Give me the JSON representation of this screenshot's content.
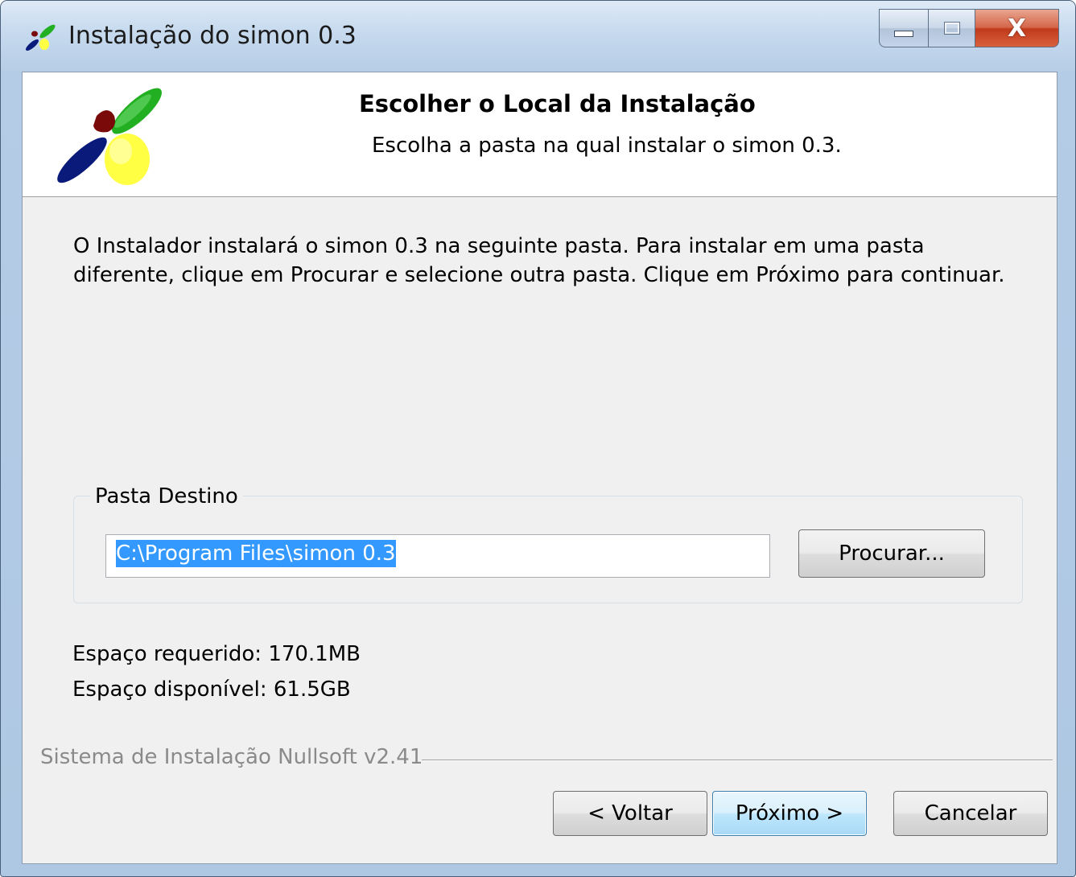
{
  "window": {
    "title": "Instalação do simon 0.3",
    "icon": "simon-logo-icon",
    "controls": {
      "minimize": "minimize-icon",
      "maximize": "maximize-icon",
      "close_glyph": "X"
    }
  },
  "header": {
    "title": "Escolher o Local da Instalação",
    "subtitle": "Escolha a pasta na qual instalar o simon 0.3."
  },
  "body": {
    "description": "O Instalador instalará o simon 0.3 na seguinte pasta. Para instalar em uma pasta diferente, clique em Procurar e selecione outra pasta. Clique em Próximo para continuar."
  },
  "destination": {
    "group_label": "Pasta Destino",
    "path_value": "C:\\Program Files\\simon 0.3",
    "browse_label": "Procurar..."
  },
  "space": {
    "required": "Espaço requerido: 170.1MB",
    "available": "Espaço disponível: 61.5GB"
  },
  "footer": {
    "branding": "Sistema de Instalação Nullsoft v2.41",
    "back_label": "< Voltar",
    "next_label": "Próximo >",
    "cancel_label": "Cancelar"
  },
  "colors": {
    "logo_green": "#22b022",
    "logo_red": "#7a0a0a",
    "logo_blue": "#0a1a7a",
    "logo_yellow": "#ffff44",
    "selection": "#3399ff"
  }
}
